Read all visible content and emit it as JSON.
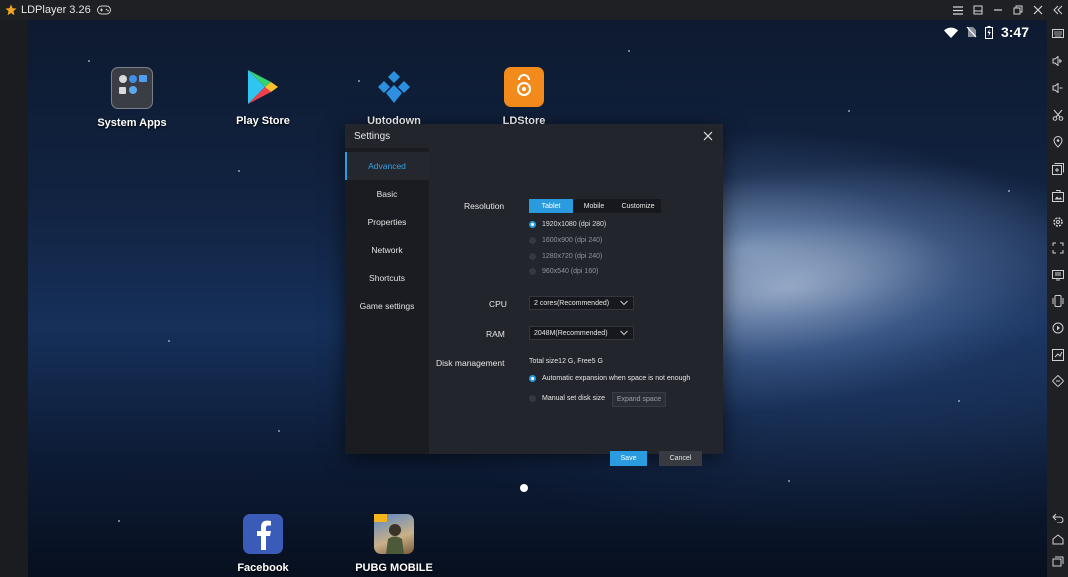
{
  "window": {
    "title": "LDPlayer 3.26",
    "controls": [
      "menu-icon",
      "minimize-to-tray-icon",
      "minimize-icon",
      "restore-icon",
      "close-icon",
      "collapse-sidebar-icon"
    ]
  },
  "android": {
    "clock": "3:47",
    "status_icons": [
      "wifi-icon",
      "no-sim-icon",
      "battery-charging-icon"
    ],
    "apps_top": [
      {
        "name": "system-apps",
        "label": "System Apps"
      },
      {
        "name": "play-store",
        "label": "Play Store"
      },
      {
        "name": "uptodown",
        "label": "Uptodown"
      },
      {
        "name": "ldstore",
        "label": "LDStore"
      }
    ],
    "apps_bottom": [
      {
        "name": "facebook",
        "label": "Facebook"
      },
      {
        "name": "pubg-mobile",
        "label": "PUBG MOBILE"
      }
    ]
  },
  "settings": {
    "title": "Settings",
    "nav": [
      {
        "label": "Advanced",
        "active": true
      },
      {
        "label": "Basic",
        "active": false
      },
      {
        "label": "Properties",
        "active": false
      },
      {
        "label": "Network",
        "active": false
      },
      {
        "label": "Shortcuts",
        "active": false
      },
      {
        "label": "Game settings",
        "active": false
      }
    ],
    "resolution": {
      "label": "Resolution",
      "modes": [
        "Tablet",
        "Mobile",
        "Customize"
      ],
      "selected_mode": "Tablet",
      "options": [
        {
          "label": "1920x1080  (dpi 280)",
          "selected": true
        },
        {
          "label": "1600x900  (dpi 240)",
          "selected": false
        },
        {
          "label": "1280x720  (dpi 240)",
          "selected": false
        },
        {
          "label": "960x540  (dpi 160)",
          "selected": false
        }
      ]
    },
    "cpu": {
      "label": "CPU",
      "value": "2 cores(Recommended)"
    },
    "ram": {
      "label": "RAM",
      "value": "2048M(Recommended)"
    },
    "disk": {
      "label": "Disk management",
      "summary": "Total size12 G,   Free5 G",
      "options": [
        {
          "label": "Automatic expansion when space is not enough",
          "selected": true
        },
        {
          "label": "Manual set disk size",
          "selected": false
        }
      ],
      "expand_button": "Expand space"
    },
    "buttons": {
      "save": "Save",
      "cancel": "Cancel"
    },
    "accent_color": "#2b9be0"
  },
  "toolbar": {
    "icons": [
      "keyboard-icon",
      "volume-up-icon",
      "volume-down-icon",
      "scissors-icon",
      "location-icon",
      "add-apk-icon",
      "screenshot-icon",
      "settings-gear-icon",
      "fullscreen-icon",
      "display-icon",
      "shake-icon",
      "record-icon",
      "sync-icon",
      "rotate-icon",
      "back-icon",
      "home-icon",
      "recent-apps-icon"
    ]
  }
}
